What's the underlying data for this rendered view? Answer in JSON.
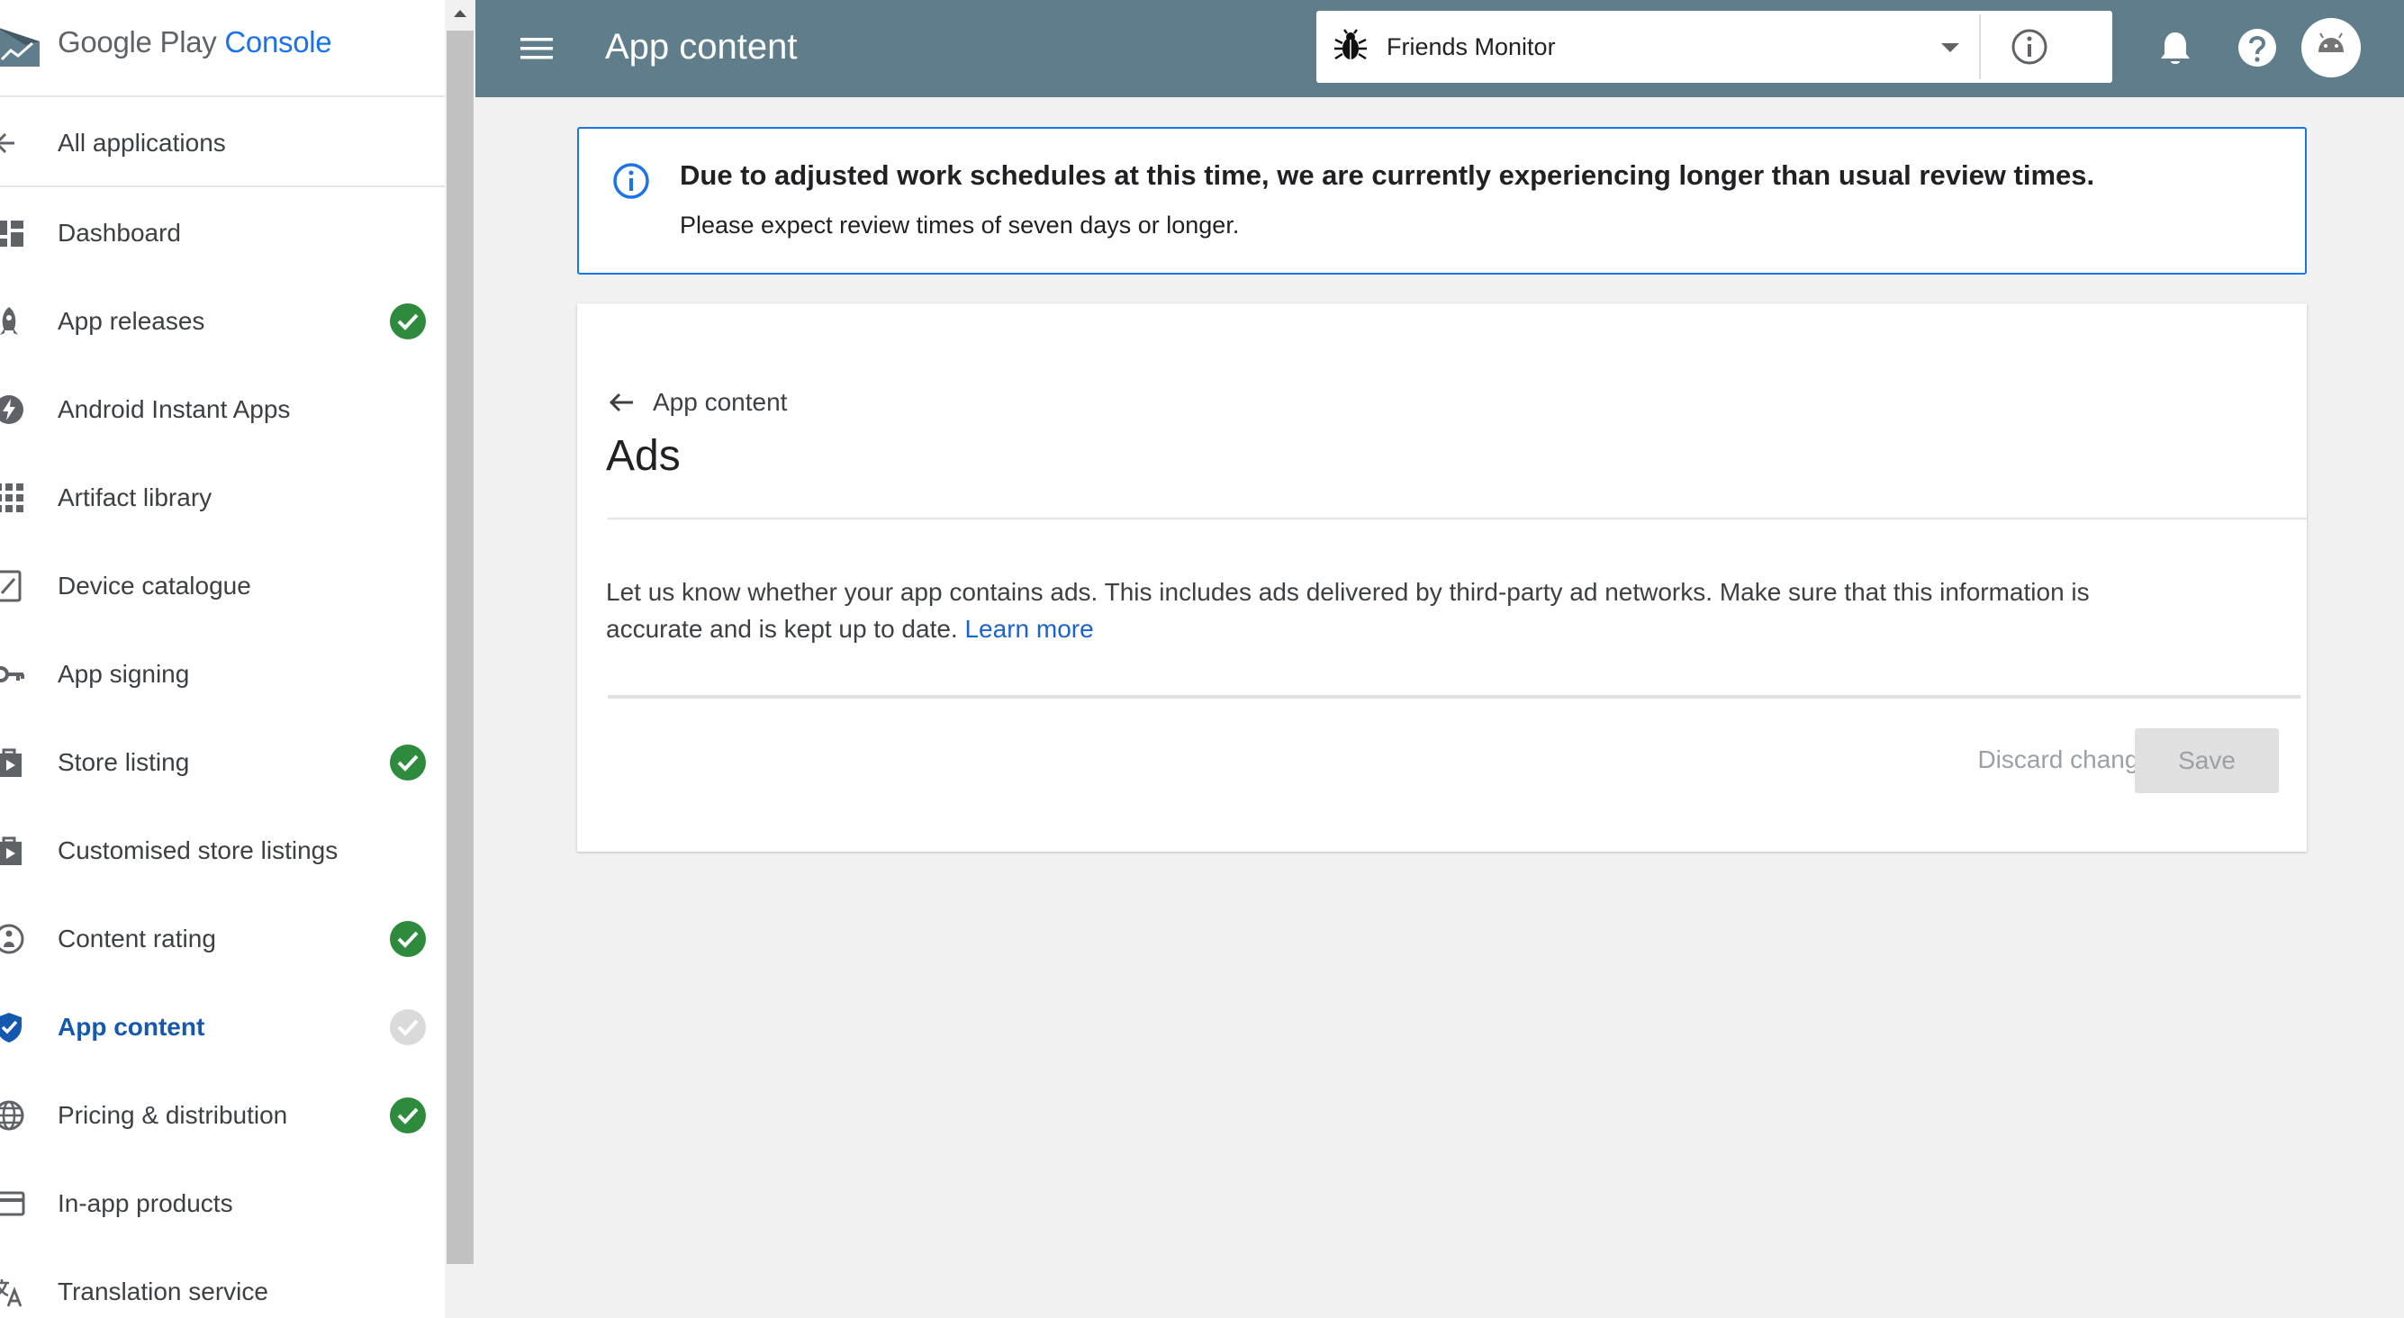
{
  "brand": {
    "google_play": "Google Play",
    "console": "Console"
  },
  "sidebar": {
    "back": {
      "label": "All applications",
      "icon": "arrow-left-icon"
    },
    "items": [
      {
        "label": "Dashboard",
        "icon": "dashboard-icon",
        "status": "none"
      },
      {
        "label": "App releases",
        "icon": "rocket-icon",
        "status": "complete"
      },
      {
        "label": "Android Instant Apps",
        "icon": "bolt-icon",
        "status": "none"
      },
      {
        "label": "Artifact library",
        "icon": "grid-icon",
        "status": "none"
      },
      {
        "label": "Device catalogue",
        "icon": "device-icon",
        "status": "none"
      },
      {
        "label": "App signing",
        "icon": "key-icon",
        "status": "none"
      },
      {
        "label": "Store listing",
        "icon": "store-play-icon",
        "status": "complete"
      },
      {
        "label": "Customised store listings",
        "icon": "store-play-icon",
        "status": "none"
      },
      {
        "label": "Content rating",
        "icon": "content-rating-icon",
        "status": "complete"
      },
      {
        "label": "App content",
        "icon": "shield-check-icon",
        "status": "incomplete",
        "active": true
      },
      {
        "label": "Pricing & distribution",
        "icon": "globe-icon",
        "status": "complete"
      },
      {
        "label": "In-app products",
        "icon": "credit-card-icon",
        "status": "none"
      },
      {
        "label": "Translation service",
        "icon": "translate-icon",
        "status": "none"
      }
    ]
  },
  "header": {
    "title": "App content",
    "app_selector": {
      "app_name": "Friends Monitor",
      "app_icon": "bug-icon"
    }
  },
  "notice": {
    "headline": "Due to adjusted work schedules at this time, we are currently experiencing longer than usual review times.",
    "subline": "Please expect review times of seven days or longer."
  },
  "card": {
    "back_label": "App content",
    "title": "Ads",
    "description": "Let us know whether your app contains ads. This includes ads delivered by third-party ad networks. Make sure that this information is accurate and is kept up to date.",
    "learn_more": "Learn more",
    "discard_label": "Discard changes",
    "save_label": "Save"
  },
  "colors": {
    "topbar": "#607d8b",
    "accent_blue": "#1a73e8",
    "active_nav": "#1558b0",
    "status_complete": "#2e8b3d",
    "status_incomplete": "#dadada"
  }
}
